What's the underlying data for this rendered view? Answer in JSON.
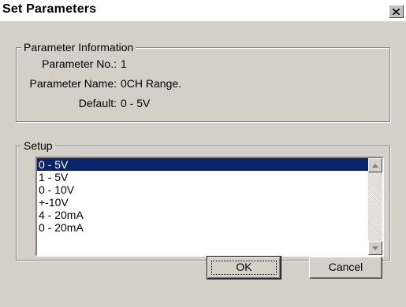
{
  "window": {
    "title": "Set Parameters"
  },
  "info_group": {
    "legend": "Parameter Information",
    "rows": [
      {
        "label": "Parameter No.:",
        "value": "1"
      },
      {
        "label": "Parameter Name:",
        "value": "0CH Range."
      },
      {
        "label": "Default:",
        "value": "0 - 5V"
      }
    ]
  },
  "setup_group": {
    "legend": "Setup",
    "options": [
      "0 - 5V",
      "1 - 5V",
      "0 - 10V",
      "+-10V",
      "4 - 20mA",
      "0 - 20mA"
    ],
    "selected_index": 0
  },
  "buttons": {
    "ok": "OK",
    "cancel": "Cancel"
  },
  "colors": {
    "selection": "#0a246a",
    "dialog_bg": "#d4d0c8"
  },
  "icons": {
    "close": "close-icon",
    "scroll_up": "scroll-up-arrow-icon",
    "scroll_down": "scroll-down-arrow-icon"
  }
}
